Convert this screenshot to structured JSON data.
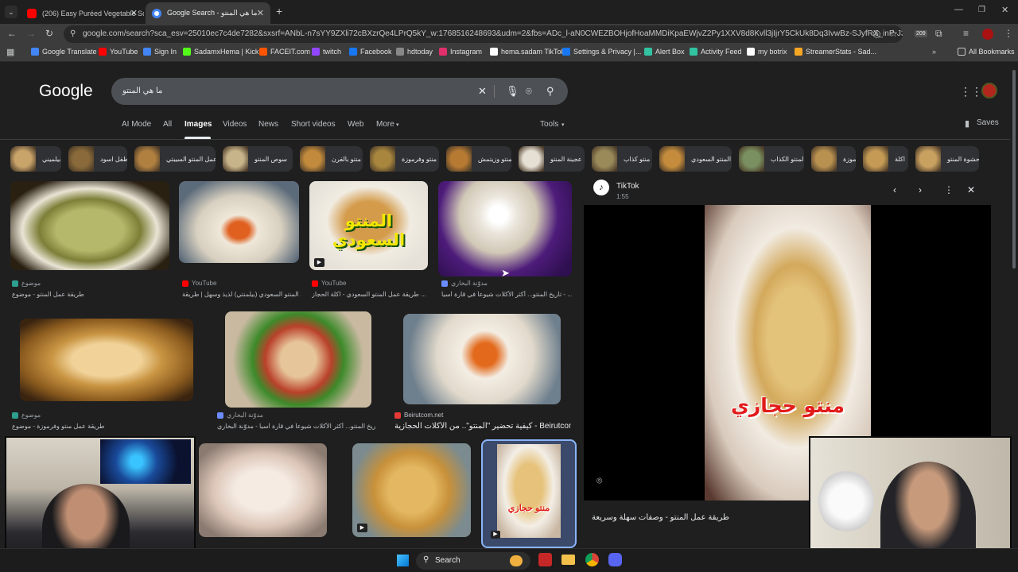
{
  "browser": {
    "tabs": [
      {
        "label": "(206) Easy Puréed Vegetable Sc",
        "icon": "youtube-icon",
        "active": false
      },
      {
        "label": "Google Search - ما هي المنتو",
        "icon": "google-icon",
        "active": true
      }
    ],
    "new_tab": "+",
    "url": "google.com/search?sca_esv=25010ec7c4de7282&sxsrf=ANbL-n7sYY9ZXli72cBXzrQe4LPrQ5kY_w:1768516248693&udm=2&fbs=ADc_l-aN0CWEZBOHjofHoaMMDiKpaEWjvZ2Py1XXV8d8Kvll3jIjrY5CkUk8Dq3IvwBz-SJyfRX_inP-J3Cs9lQZu9Jy...",
    "extension_badge": "209",
    "bookmarks": [
      {
        "label": "Google Translate",
        "color": "#4285f4"
      },
      {
        "label": "YouTube",
        "color": "#ff0000"
      },
      {
        "label": "Sign In",
        "color": "#4285f4"
      },
      {
        "label": "SadamxHema | Kick",
        "color": "#53fc18"
      },
      {
        "label": "FACEIT.com",
        "color": "#ff5500"
      },
      {
        "label": "twitch",
        "color": "#9146ff"
      },
      {
        "label": "Facebook",
        "color": "#1877f2"
      },
      {
        "label": "hdtoday",
        "color": "#888888"
      },
      {
        "label": "Instagram",
        "color": "#e1306c"
      },
      {
        "label": "hema.sadam TikTok",
        "color": "#ffffff"
      },
      {
        "label": "Settings & Privacy |...",
        "color": "#1877f2"
      },
      {
        "label": "Alert Box",
        "color": "#31c3a2"
      },
      {
        "label": "Activity Feed",
        "color": "#31c3a2"
      },
      {
        "label": "my botrix",
        "color": "#ffffff"
      },
      {
        "label": "StreamerStats - Sad...",
        "color": "#f5a623"
      }
    ],
    "all_bookmarks": "All Bookmarks"
  },
  "google": {
    "logo": "Google",
    "query": "ما هي المنتو",
    "nav": [
      "AI Mode",
      "All",
      "Images",
      "Videos",
      "News",
      "Short videos",
      "Web",
      "More"
    ],
    "active_nav": "Images",
    "tools": "Tools",
    "saves": "Saves",
    "chips": [
      "بيلميني",
      "ظفل اسود",
      "عمل المنتو السيبتي",
      "سوص المنتو",
      "منتو بالفرن",
      "منتو وفرموزة",
      "منتو وزيتمش",
      "عجينة المنتو",
      "منتو كذاب",
      "المنتو السعودي",
      "المنتو الكذاب",
      "منتو فرموزة",
      "اكلة",
      "حشوة المنتو"
    ],
    "results": [
      {
        "source": "موضوع",
        "caption": "طريقة عمل المنتو - موضوع",
        "color": "#2e9e8f"
      },
      {
        "source": "YouTube",
        "caption": "المنتو السعودي (بيلمنتي) لذيذ وسهل | طريقة ...",
        "color": "#ff0000"
      },
      {
        "source": "YouTube",
        "caption": "طريقة عمل المنتو السعودي - اكلة الحجاز ...",
        "color": "#ff0000"
      },
      {
        "source": "مدوّنة البخاري",
        "caption": "تاريخ المنتو... أكثر الأكلات شيوعاً في قارة آسيا - ...",
        "color": "#6b8cff"
      },
      {
        "source": "موضوع",
        "caption": "طريقة عمل منتو وفرموزة - موضوع",
        "color": "#2e9e8f"
      },
      {
        "source": "مدوّنة البخاري",
        "caption": "تاريخ المنتو... أكثر الأكلات شيوعاً في قارة آسيا - مدوّنة البخاري",
        "color": "#6b8cff"
      },
      {
        "source": "Beirutcom.net",
        "caption": "كيفية تحضير \"المنتو\".. من الأكلات الحجازية - Beirutcom.net",
        "color": "#e53935"
      }
    ],
    "overlay_texts": {
      "saudi": "المنتو السعودي",
      "hijazi": "منتو حجازي"
    }
  },
  "panel": {
    "source": "TikTok",
    "duration": "1:55",
    "video_text": "منتو حجازي",
    "title": "طريقة عمل المنتو - وصفات سهلة وسريعة"
  },
  "taskbar": {
    "search": "Search"
  }
}
